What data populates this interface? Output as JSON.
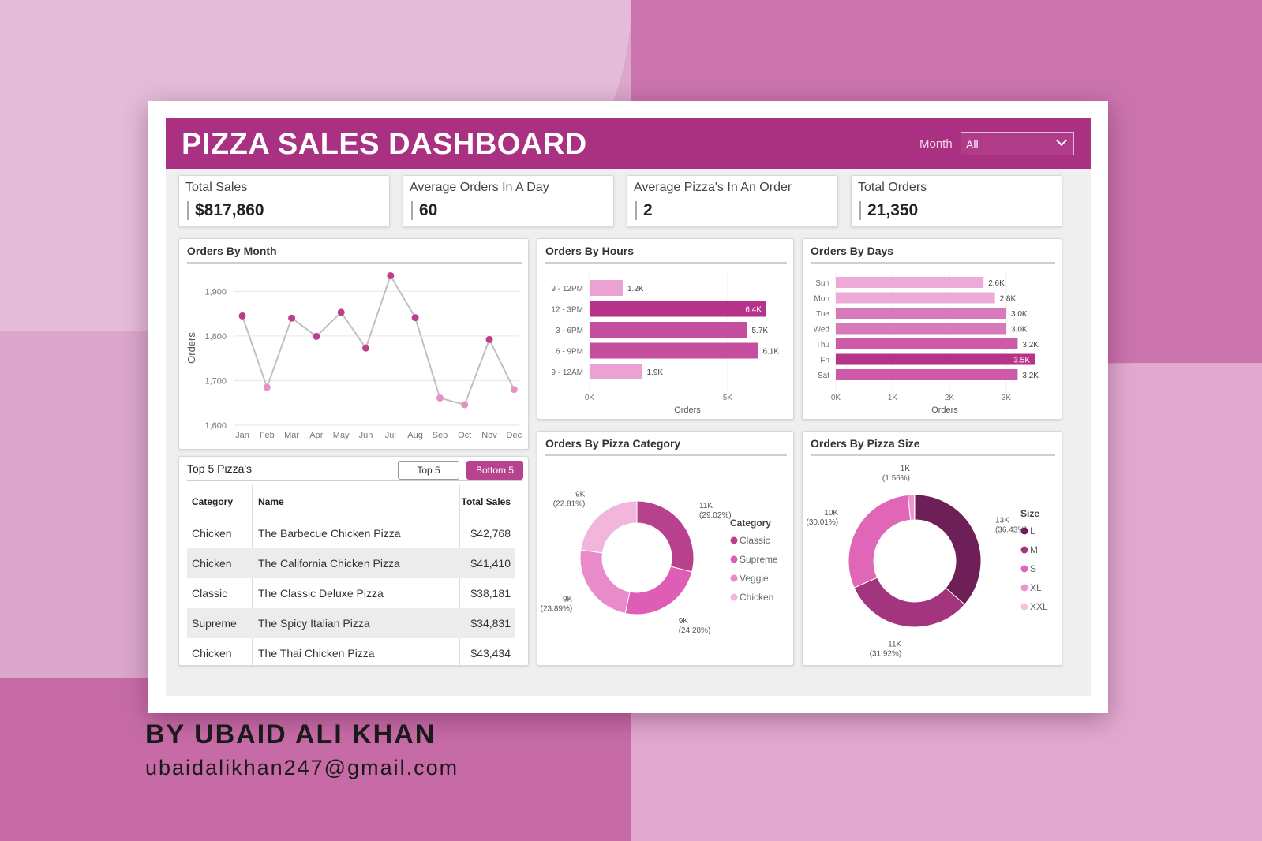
{
  "header": {
    "title": "PIZZA SALES DASHBOARD",
    "month_label": "Month",
    "month_value": "All"
  },
  "kpis": [
    {
      "label": "Total Sales",
      "value": "$817,860"
    },
    {
      "label": "Average Orders In A Day",
      "value": "60"
    },
    {
      "label": "Average Pizza's In An Order",
      "value": "2"
    },
    {
      "label": "Total Orders",
      "value": "21,350"
    }
  ],
  "top_pizzas": {
    "title": "Top 5 Pizza's",
    "toggle_top": "Top 5",
    "toggle_bottom": "Bottom 5",
    "columns": [
      "Category",
      "Name",
      "Total Sales"
    ],
    "rows": [
      [
        "Chicken",
        "The Barbecue Chicken Pizza",
        "$42,768"
      ],
      [
        "Chicken",
        "The California Chicken Pizza",
        "$41,410"
      ],
      [
        "Classic",
        "The Classic Deluxe Pizza",
        "$38,181"
      ],
      [
        "Supreme",
        "The Spicy Italian Pizza",
        "$34,831"
      ],
      [
        "Chicken",
        "The Thai Chicken Pizza",
        "$43,434"
      ]
    ]
  },
  "colors": {
    "brand": "#aa3182",
    "line": "#c0c0c0",
    "point_dark": "#bb3f8c",
    "point_light": "#e690c5"
  },
  "chart_data": [
    {
      "type": "line",
      "title": "Orders By Month",
      "ylabel": "Orders",
      "xlabel": "",
      "categories": [
        "Jan",
        "Feb",
        "Mar",
        "Apr",
        "May",
        "Jun",
        "Jul",
        "Aug",
        "Sep",
        "Oct",
        "Nov",
        "Dec"
      ],
      "values": [
        1845,
        1685,
        1840,
        1799,
        1853,
        1773,
        1935,
        1841,
        1661,
        1646,
        1792,
        1680
      ],
      "ylim": [
        1600,
        1950
      ],
      "yticks": [
        "1,600",
        "1,700",
        "1,800",
        "1,900"
      ],
      "grid": true
    },
    {
      "type": "bar",
      "orientation": "horizontal",
      "title": "Orders By Hours",
      "xlabel": "Orders",
      "categories": [
        "9 - 12PM",
        "12 - 3PM",
        "3 - 6PM",
        "6 - 9PM",
        "9 - 12AM"
      ],
      "values": [
        1.2,
        6.4,
        5.7,
        6.1,
        1.9
      ],
      "labels": [
        "1.2K",
        "6.4K",
        "5.7K",
        "6.1K",
        "1.9K"
      ],
      "xticks": [
        "0K",
        "5K"
      ],
      "xlim": [
        0,
        10
      ],
      "unit": "K"
    },
    {
      "type": "bar",
      "orientation": "horizontal",
      "title": "Orders By Days",
      "xlabel": "Orders",
      "categories": [
        "Sun",
        "Mon",
        "Tue",
        "Wed",
        "Thu",
        "Fri",
        "Sat"
      ],
      "values": [
        2.6,
        2.8,
        3.0,
        3.0,
        3.2,
        3.5,
        3.2
      ],
      "labels": [
        "2.6K",
        "2.8K",
        "3.0K",
        "3.0K",
        "3.2K",
        "3.5K",
        "3.2K"
      ],
      "xticks": [
        "0K",
        "1K",
        "2K",
        "3K"
      ],
      "xlim": [
        0,
        3.6
      ],
      "unit": "K"
    },
    {
      "type": "pie",
      "title": "Orders By Pizza Category",
      "legend_title": "Category",
      "series": [
        {
          "name": "Classic",
          "value": 29.02,
          "label": "11K",
          "pct": "(29.02%)",
          "color": "#b7418d"
        },
        {
          "name": "Supreme",
          "value": 24.28,
          "label": "9K",
          "pct": "(24.28%)",
          "color": "#de5eb5"
        },
        {
          "name": "Veggie",
          "value": 23.89,
          "label": "9K",
          "pct": "(23.89%)",
          "color": "#e98acb"
        },
        {
          "name": "Chicken",
          "value": 22.81,
          "label": "9K",
          "pct": "(22.81%)",
          "color": "#f2b6dd"
        }
      ]
    },
    {
      "type": "pie",
      "title": "Orders By Pizza Size",
      "legend_title": "Size",
      "series": [
        {
          "name": "L",
          "value": 36.43,
          "label": "13K",
          "pct": "(36.43%)",
          "color": "#6e1f57"
        },
        {
          "name": "M",
          "value": 31.92,
          "label": "11K",
          "pct": "(31.92%)",
          "color": "#a3357e"
        },
        {
          "name": "S",
          "value": 30.01,
          "label": "10K",
          "pct": "(30.01%)",
          "color": "#e066b8"
        },
        {
          "name": "XL",
          "value": 1.56,
          "label": "1K",
          "pct": "(1.56%)",
          "color": "#ef94cf"
        },
        {
          "name": "XXL",
          "value": 0.08,
          "label": "",
          "pct": "",
          "color": "#f6c2e4"
        }
      ]
    }
  ],
  "credits": {
    "name": "BY UBAID ALI KHAN",
    "email": "ubaidalikhan247@gmail.com"
  }
}
